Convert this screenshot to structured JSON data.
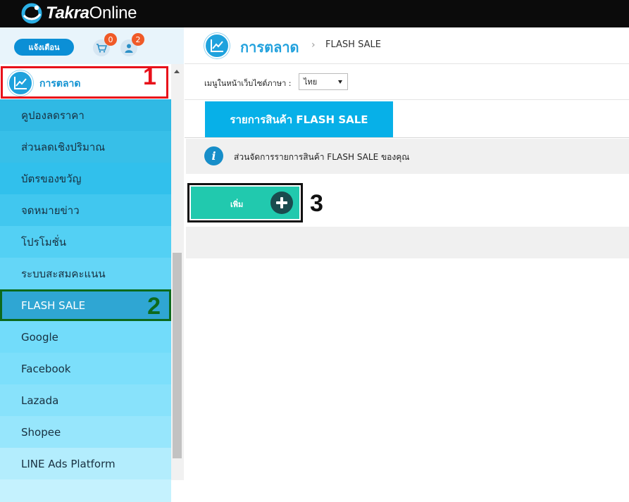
{
  "app": {
    "logo_text_bold": "Takra",
    "logo_text_light": "Online"
  },
  "sidebar": {
    "notify_label": "แจ้งเตือน",
    "cart_badge": "0",
    "user_badge": "2",
    "category_label": "การตลาด",
    "items": [
      {
        "label": "คูปองลดราคา",
        "bg": "#30b9e4"
      },
      {
        "label": "ส่วนลดเชิงปริมาณ",
        "bg": "#37bfe8"
      },
      {
        "label": "บัตรของขวัญ",
        "bg": "#31c0ec"
      },
      {
        "label": "จดหมายข่าว",
        "bg": "#41c7ef"
      },
      {
        "label": "โปรโมชั่น",
        "bg": "#53d0f4"
      },
      {
        "label": "ระบบสะสมคะแนน",
        "bg": "#64d6f7"
      },
      {
        "label": "FLASH SALE",
        "bg": "#2fa6d3"
      },
      {
        "label": "Google",
        "bg": "#72dcfa"
      },
      {
        "label": "Facebook",
        "bg": "#7cdffb"
      },
      {
        "label": "Lazada",
        "bg": "#88e2fb"
      },
      {
        "label": "Shopee",
        "bg": "#97e6fc"
      },
      {
        "label": "LINE Ads Platform",
        "bg": "#b3edfd"
      },
      {
        "label": "",
        "bg": "#c5f2fe"
      }
    ]
  },
  "annotations": {
    "one": "1",
    "two": "2",
    "three": "3"
  },
  "main": {
    "breadcrumb_title": "การตลาด",
    "breadcrumb_sep": "›",
    "breadcrumb_current": "FLASH SALE",
    "lang_label": "เมนูในหน้าเว็บไซต์ภาษา :",
    "lang_value": "ไทย",
    "tab_label": "รายการสินค้า FLASH SALE",
    "info_text": "ส่วนจัดการรายการสินค้า FLASH SALE ของคุณ",
    "add_label": "เพิ่ม"
  },
  "colors": {
    "accent": "#07b0e8",
    "add": "#21c9ae",
    "badge": "#f05a28",
    "annot_red": "#e8101a",
    "annot_green": "#0c6a1c"
  }
}
